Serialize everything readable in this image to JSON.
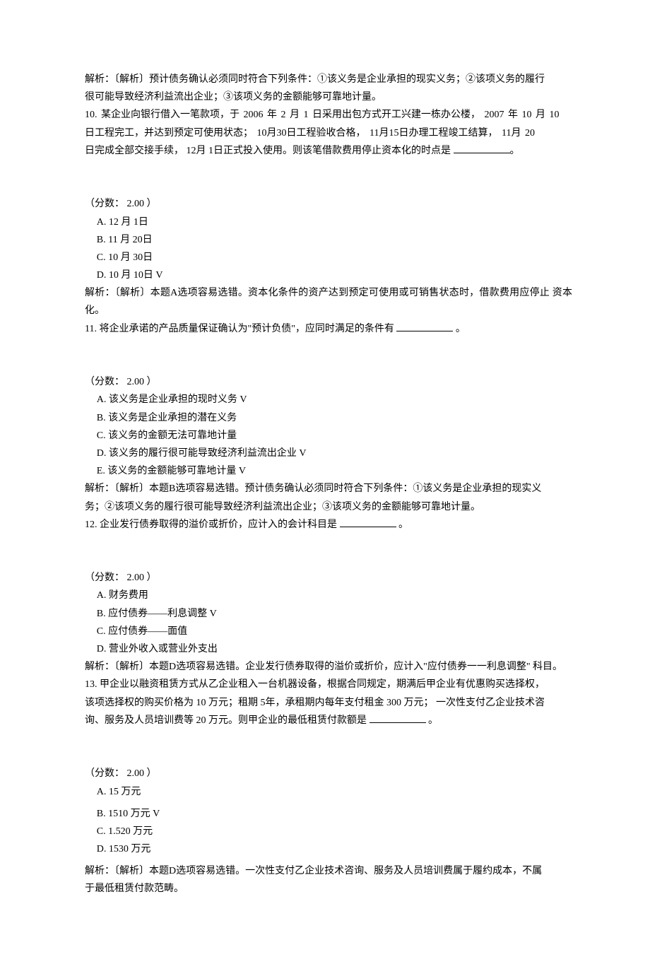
{
  "q9_analysis_l1": "解析：〔解析〕预计债务确认必须同时符合下列条件：①该义务是企业承担的现实义务；②该项义务的履行",
  "q9_analysis_l2": "很可能导致经济利益流出企业；③该项义务的金额能够可靠地计量。",
  "q10_stem_l1": "10. 某企业向银行借入一笔款项，于  2006 年  2 月  1 日采用出包方式开工兴建一栋办公楼，  2007 年  10 月  10",
  "q10_stem_l2": "日工程完工，并达到预定可使用状态；   10月30日工程验收合格，   11月15日办理工程竣工结算，   11月   20",
  "q10_stem_l3_pre": "日完成全部交接手续，  12月 1日正式投入使用。则该笔借款费用停止资本化的时点是  ",
  "q10_stem_l3_post": "。",
  "q10_score": "（分数：  2.00 ）",
  "q10_optA": "A.  12 月 1日",
  "q10_optB": "B.  11 月 20日",
  "q10_optC": "C.  10 月 30日",
  "q10_optD": "D.  10 月 10日  V",
  "q10_analysis": "解析：〔解析〕本题A选项容易选错。资本化条件的资产达到预定可使用或可销售状态时，借款费用应停止 资本化。",
  "q11_stem_pre": "11. 将企业承诺的产品质量保证确认为\"预计负债\"，应同时满足的条件有  ",
  "q11_stem_post": "  。",
  "q11_score": "（分数：  2.00 ）",
  "q11_optA": "A.  该义务是企业承担的现时义务  V",
  "q11_optB": "B.  该义务是企业承担的潜在义务",
  "q11_optC": "C.  该义务的金额无法可靠地计量",
  "q11_optD": "D.  该义务的履行很可能导致经济利益流出企业  V",
  "q11_optE": "E.  该义务的金额能够可靠地计量  V",
  "q11_analysis_l1": "解析：〔解析〕本题B选项容易选错。预计债务确认必须同时符合下列条件：①该义务是企业承担的现实义",
  "q11_analysis_l2": "务；②该项义务的履行很可能导致经济利益流出企业；③该项义务的金额能够可靠地计量。",
  "q12_stem_pre": "12. 企业发行债券取得的溢价或折价，应计入的会计科目是  ",
  "q12_stem_post": "  。",
  "q12_score": "（分数：  2.00 ）",
  "q12_optA": "A.  财务费用",
  "q12_optB": "B.  应付债券——利息调整  V",
  "q12_optC": "C.  应付债券——面值",
  "q12_optD": "D.  营业外收入或营业外支出",
  "q12_analysis": "解析：〔解析〕本题D选项容易选错。企业发行债券取得的溢价或折价，应计入\"应付债券一一利息调整\"  科目。",
  "q13_stem_l1": "13. 甲企业以融资租赁方式从乙企业租入一台机器设备，根据合同规定，期满后甲企业有优惠购买选择权，",
  "q13_stem_l2": "该项选择权的购买价格为  10 万元；租期  5年，承租期内每年支付租金  300 万元；  一次性支付乙企业技术咨",
  "q13_stem_l3_pre": "询、服务及人员培训费等  20 万元。则甲企业的最低租赁付款额是  ",
  "q13_stem_l3_post": "  。",
  "q13_score": "（分数：  2.00 ）",
  "q13_optA": "A.  15 万元",
  "q13_optB": "B.  1510 万元  V",
  "q13_optC": "C.  1.520 万元",
  "q13_optD": "D.  1530 万元",
  "q13_analysis_l1": "解析：〔解析〕本题D选项容易选错。一次性支付乙企业技术咨询、服务及人员培训费属于履约成本，不属",
  "q13_analysis_l2": "于最低租赁付款范畴。"
}
